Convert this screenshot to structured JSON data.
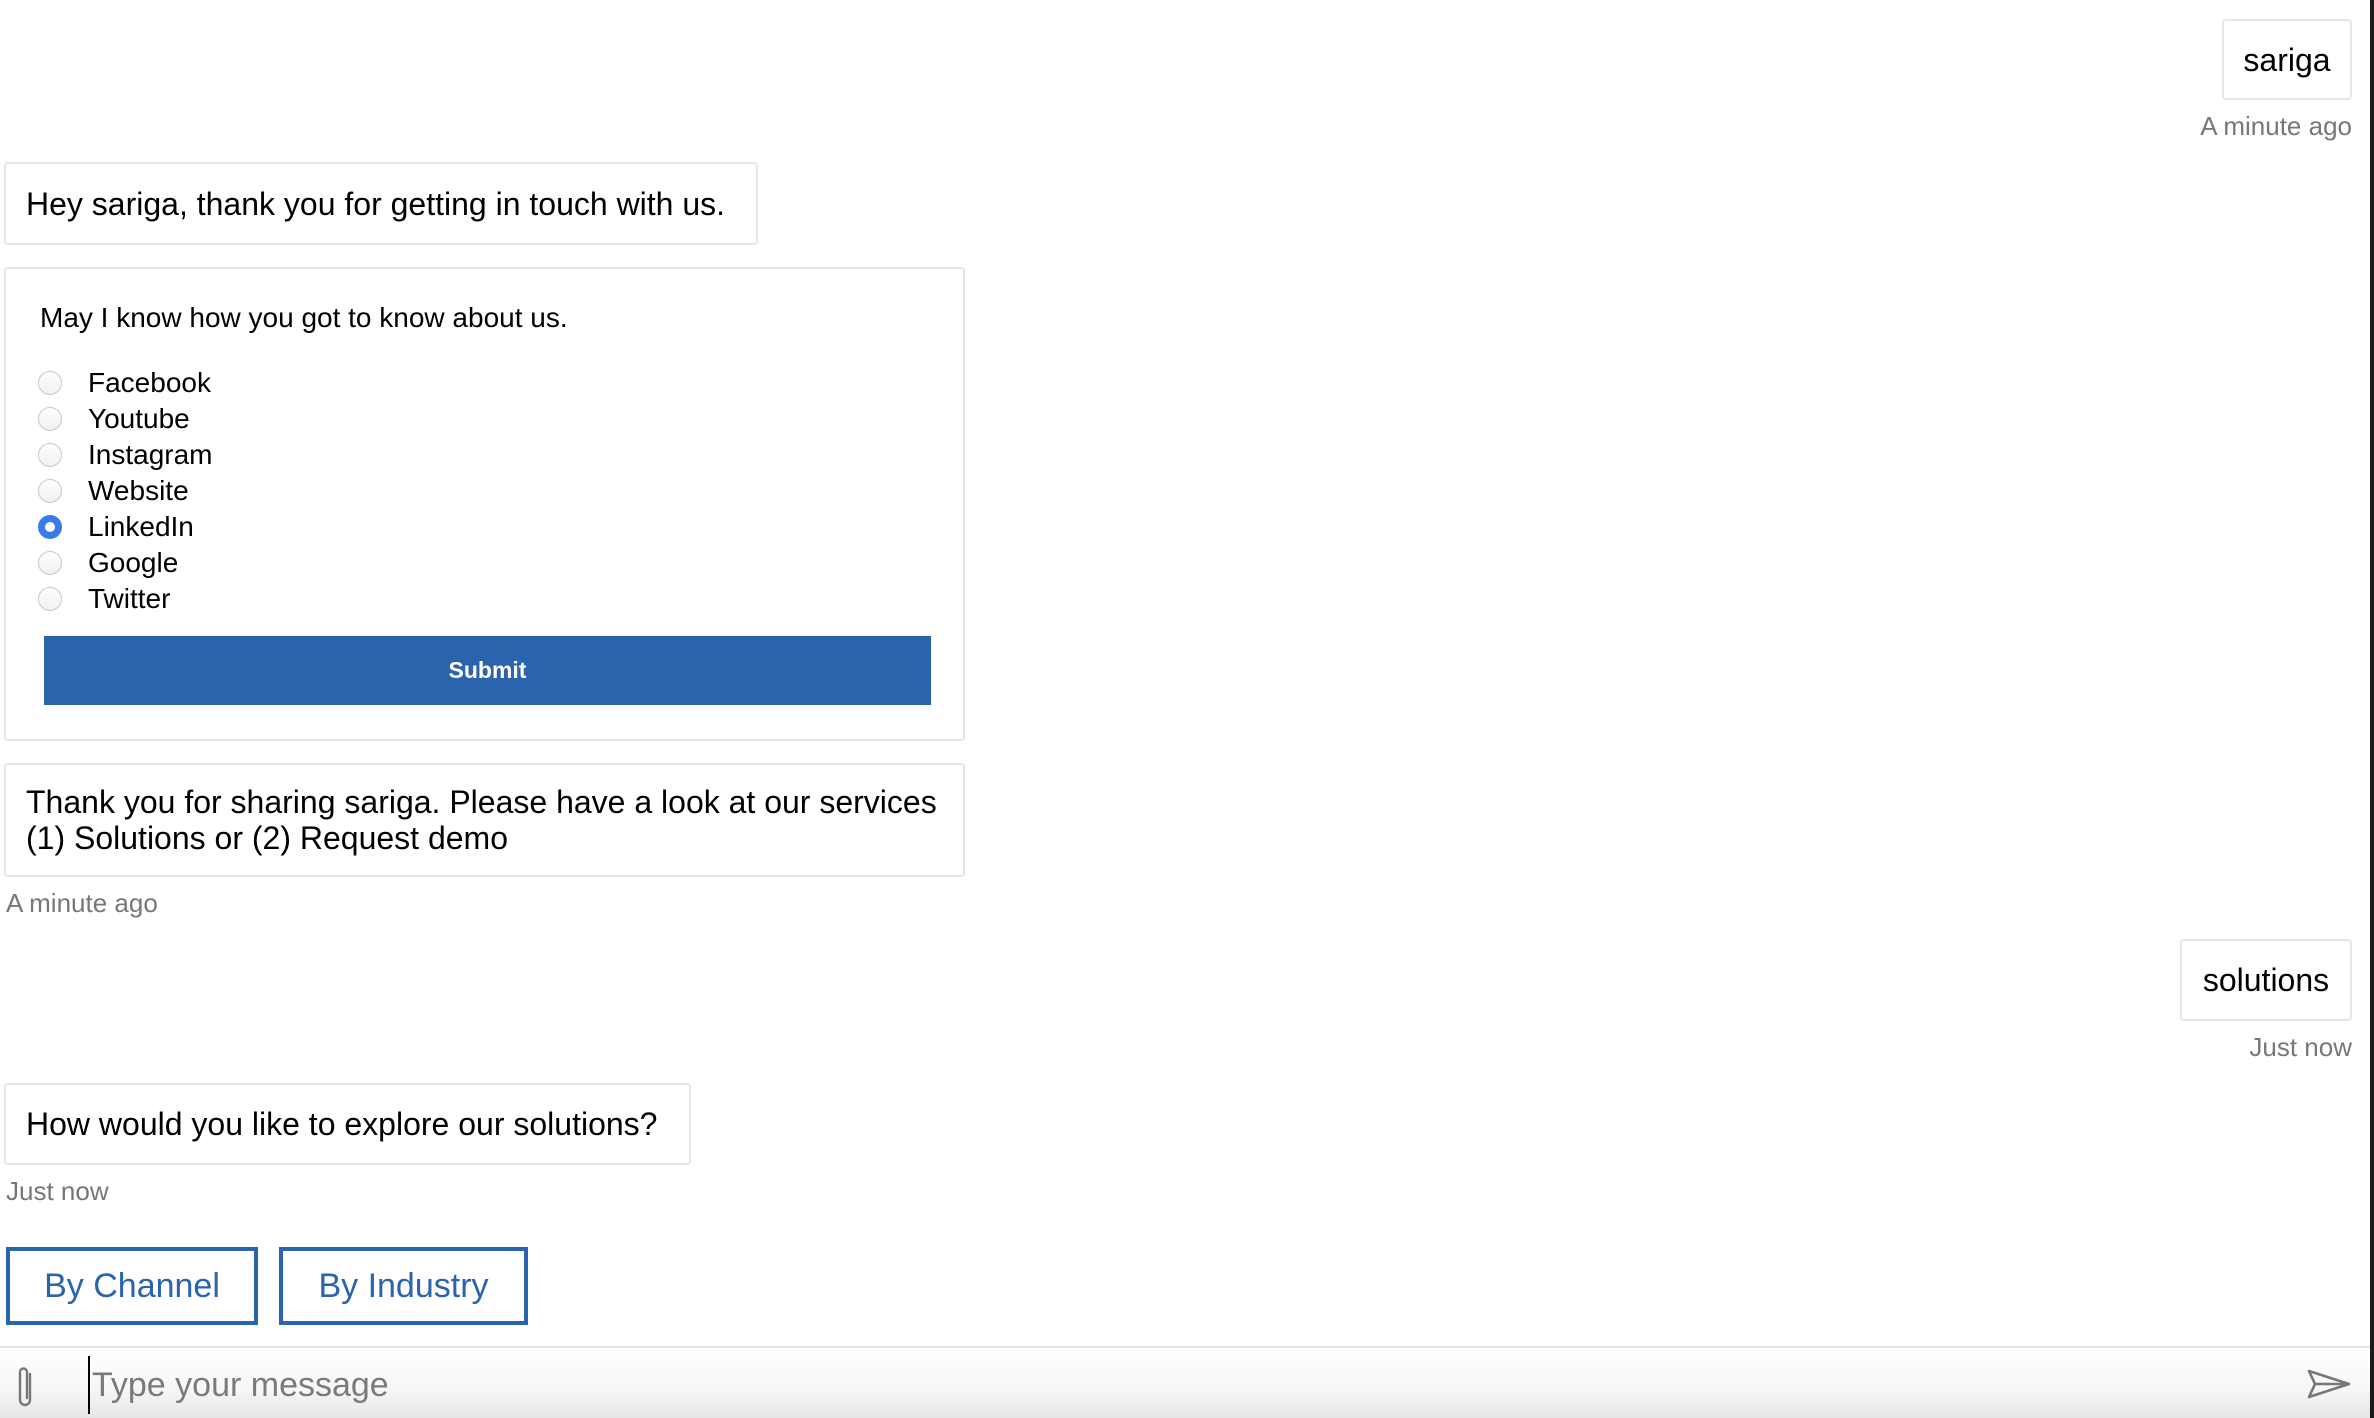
{
  "messages": [
    {
      "from": "user",
      "text": "sariga",
      "timestamp": "A minute ago"
    },
    {
      "from": "bot",
      "text": "Hey sariga, thank you for getting in touch with us."
    },
    {
      "from": "bot",
      "text": "Thank you for sharing sariga. Please have a look at our services (1) Solutions or (2) Request demo",
      "line1": "Thank you for sharing sariga. Please have a look at our services",
      "line2": "(1) Solutions or (2) Request demo",
      "timestamp": "A minute ago"
    },
    {
      "from": "user",
      "text": "solutions",
      "timestamp": "Just now"
    },
    {
      "from": "bot",
      "text": "How would you like to explore our solutions?",
      "timestamp": "Just now"
    }
  ],
  "form": {
    "question": "May I know how you got to know about us.",
    "options": [
      "Facebook",
      "Youtube",
      "Instagram",
      "Website",
      "LinkedIn",
      "Google",
      "Twitter"
    ],
    "selected": "LinkedIn",
    "submit_label": "Submit"
  },
  "quick_replies": [
    "By Channel",
    "By Industry"
  ],
  "composer": {
    "placeholder": "Type your message",
    "value": ""
  },
  "colors": {
    "accent": "#2b63ac",
    "radio_checked": "#3a7be8",
    "timestamp": "#777777",
    "bubble_border": "#e6e6e6"
  }
}
